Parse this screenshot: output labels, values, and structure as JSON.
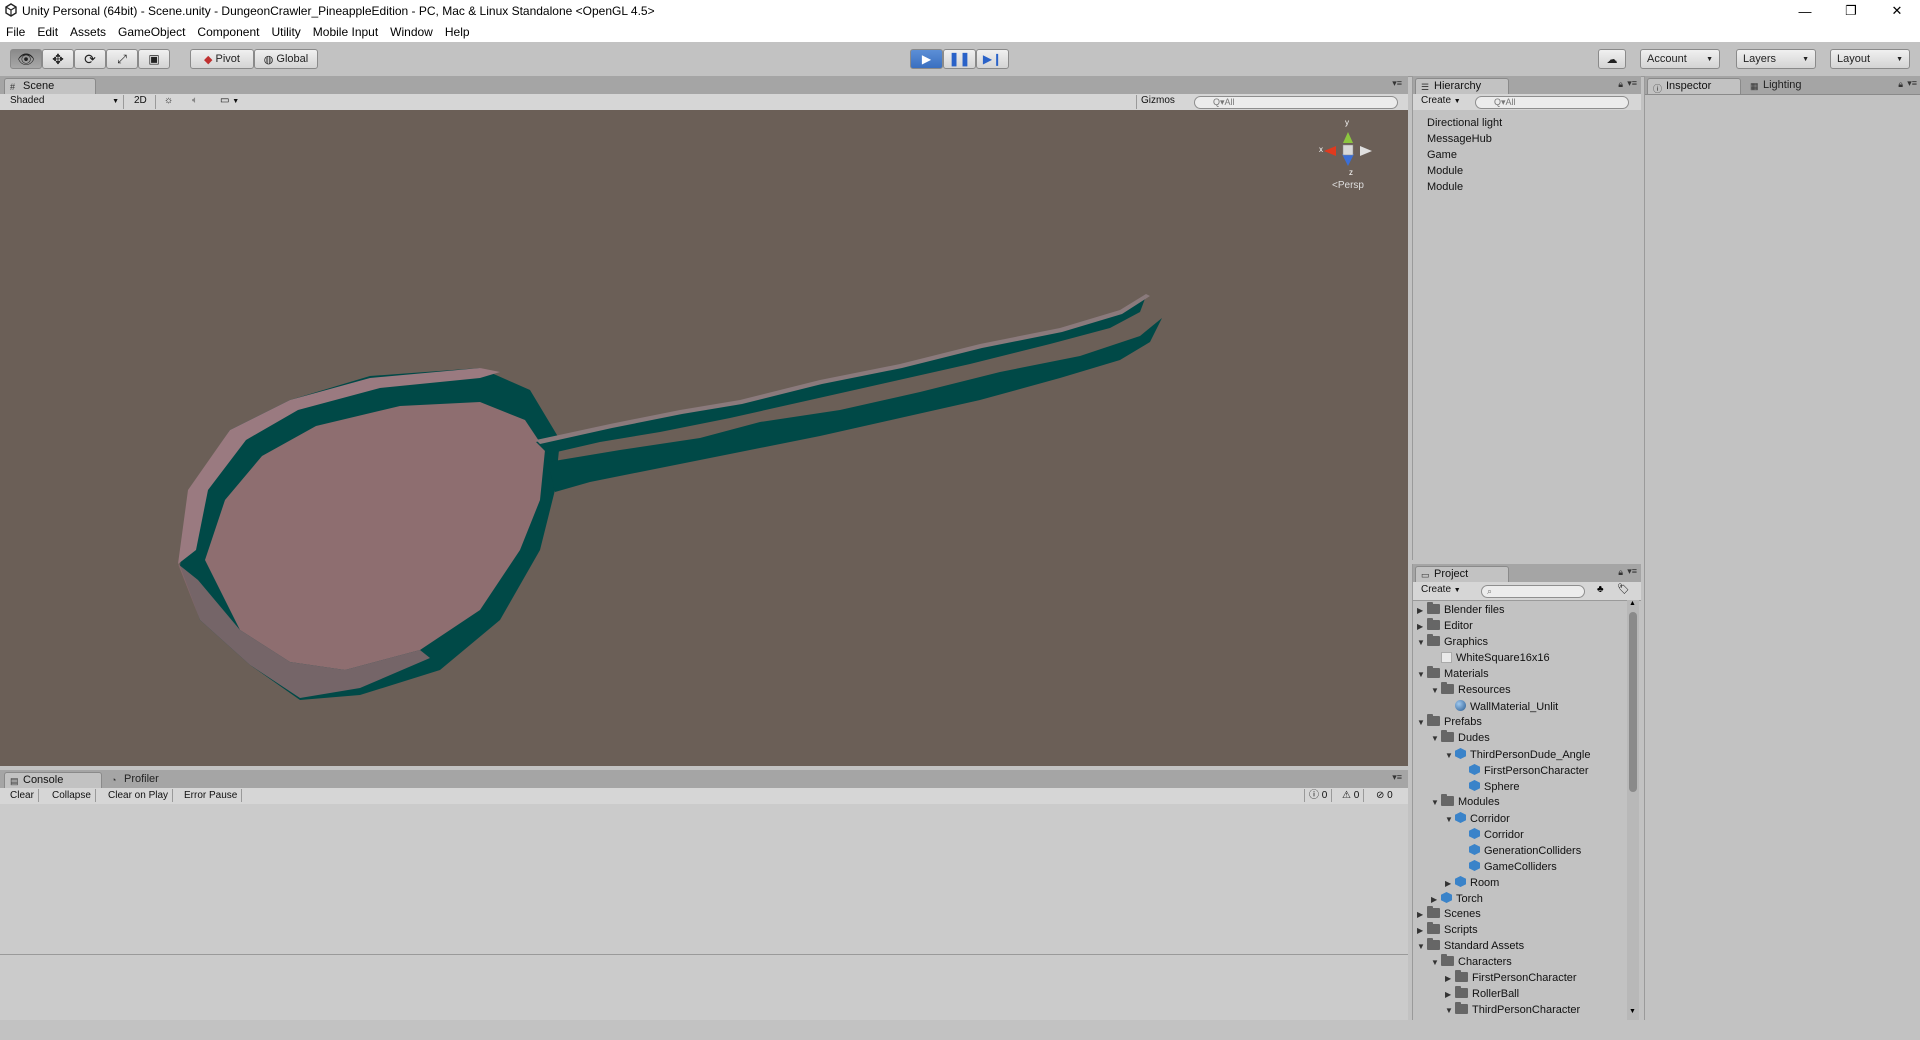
{
  "window": {
    "title": "Unity Personal (64bit) - Scene.unity - DungeonCrawler_PineappleEdition - PC, Mac & Linux Standalone <OpenGL 4.5>",
    "controls": [
      "minimize",
      "restore",
      "close"
    ]
  },
  "menu": [
    "File",
    "Edit",
    "Assets",
    "GameObject",
    "Component",
    "Utility",
    "Mobile Input",
    "Window",
    "Help"
  ],
  "toolbar": {
    "pivot": "Pivot",
    "global": "Global",
    "account": "Account",
    "layers": "Layers",
    "layout": "Layout"
  },
  "scene": {
    "tab": "Scene",
    "shading": "Shaded",
    "mode_2d": "2D",
    "gizmos": "Gizmos",
    "search_placeholder": "Q▾All",
    "gizmo": {
      "y": "y",
      "x": "x",
      "z": "z",
      "persp": "Persp"
    }
  },
  "hierarchy": {
    "tab": "Hierarchy",
    "create": "Create",
    "search_placeholder": "Q▾All",
    "items": [
      "Directional light",
      "MessageHub",
      "Game",
      "Module",
      "Module"
    ]
  },
  "inspector": {
    "tab": "Inspector",
    "lighting_tab": "Lighting"
  },
  "project": {
    "tab": "Project",
    "create": "Create",
    "tree": [
      {
        "label": "Blender files",
        "icon": "folder",
        "depth": 0,
        "arrow": "right"
      },
      {
        "label": "Editor",
        "icon": "folder",
        "depth": 0,
        "arrow": "right"
      },
      {
        "label": "Graphics",
        "icon": "folder",
        "depth": 0,
        "arrow": "down"
      },
      {
        "label": "WhiteSquare16x16",
        "icon": "texture",
        "depth": 1,
        "arrow": ""
      },
      {
        "label": "Materials",
        "icon": "folder",
        "depth": 0,
        "arrow": "down"
      },
      {
        "label": "Resources",
        "icon": "folder",
        "depth": 1,
        "arrow": "down"
      },
      {
        "label": "WallMaterial_Unlit",
        "icon": "material",
        "depth": 2,
        "arrow": ""
      },
      {
        "label": "Prefabs",
        "icon": "folder",
        "depth": 0,
        "arrow": "down"
      },
      {
        "label": "Dudes",
        "icon": "folder",
        "depth": 1,
        "arrow": "down"
      },
      {
        "label": "ThirdPersonDude_Angle",
        "icon": "prefab",
        "depth": 2,
        "arrow": "down"
      },
      {
        "label": "FirstPersonCharacter",
        "icon": "prefab",
        "depth": 3,
        "arrow": ""
      },
      {
        "label": "Sphere",
        "icon": "prefab",
        "depth": 3,
        "arrow": ""
      },
      {
        "label": "Modules",
        "icon": "folder",
        "depth": 1,
        "arrow": "down"
      },
      {
        "label": "Corridor",
        "icon": "prefab",
        "depth": 2,
        "arrow": "down"
      },
      {
        "label": "Corridor",
        "icon": "prefab",
        "depth": 3,
        "arrow": ""
      },
      {
        "label": "GenerationColliders",
        "icon": "prefab",
        "depth": 3,
        "arrow": ""
      },
      {
        "label": "GameColliders",
        "icon": "prefab",
        "depth": 3,
        "arrow": ""
      },
      {
        "label": "Room",
        "icon": "prefab",
        "depth": 2,
        "arrow": "right"
      },
      {
        "label": "Torch",
        "icon": "prefab",
        "depth": 1,
        "arrow": "right"
      },
      {
        "label": "Scenes",
        "icon": "folder",
        "depth": 0,
        "arrow": "right"
      },
      {
        "label": "Scripts",
        "icon": "folder",
        "depth": 0,
        "arrow": "right"
      },
      {
        "label": "Standard Assets",
        "icon": "folder",
        "depth": 0,
        "arrow": "down"
      },
      {
        "label": "Characters",
        "icon": "folder",
        "depth": 1,
        "arrow": "down"
      },
      {
        "label": "FirstPersonCharacter",
        "icon": "folder",
        "depth": 2,
        "arrow": "right"
      },
      {
        "label": "RollerBall",
        "icon": "folder",
        "depth": 2,
        "arrow": "right"
      },
      {
        "label": "ThirdPersonCharacter",
        "icon": "folder",
        "depth": 2,
        "arrow": "down"
      }
    ]
  },
  "console": {
    "tab": "Console",
    "profiler_tab": "Profiler",
    "buttons": [
      "Clear",
      "Collapse",
      "Clear on Play",
      "Error Pause"
    ],
    "counts": {
      "info": "0",
      "warn": "0",
      "error": "0"
    }
  },
  "colors": {
    "scene_bg": "#6b5f57",
    "wall_dark": "#004947",
    "wall_floor": "#8e6e70",
    "wall_top": "#9a7a80",
    "play_blue": "#4a82d0"
  }
}
